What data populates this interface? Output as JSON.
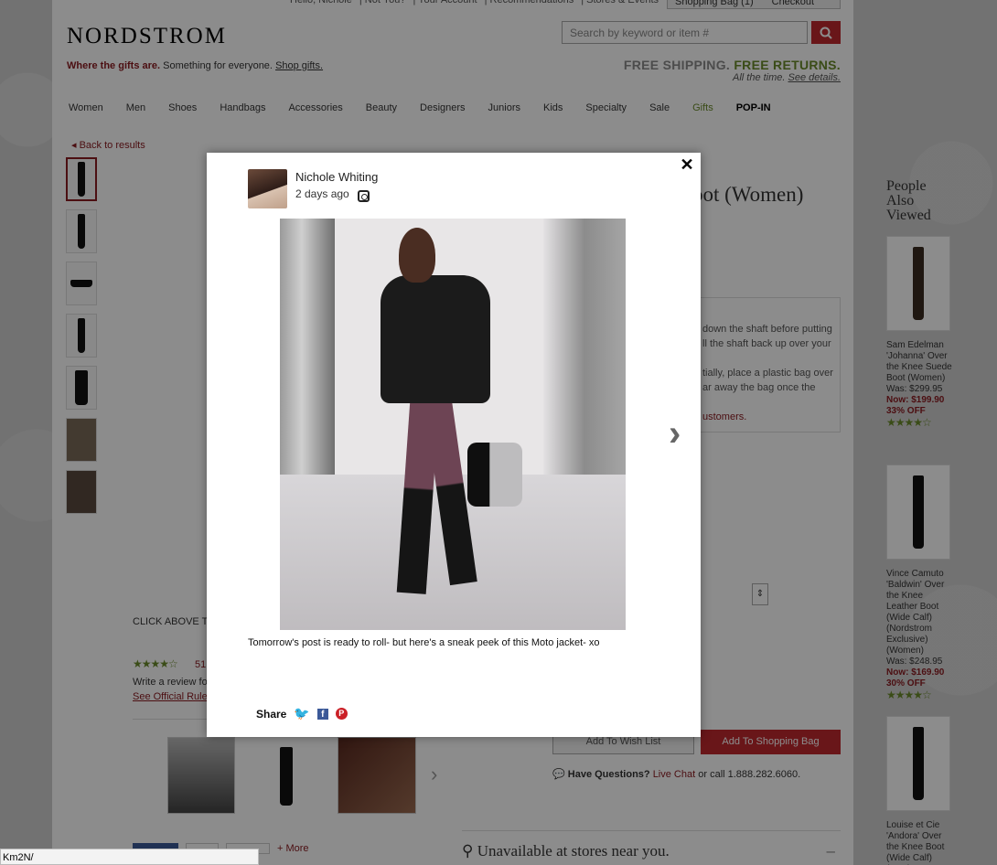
{
  "header": {
    "logo": "NORDSTROM",
    "search_placeholder": "Search by keyword or item #",
    "promo_bold": "Where the gifts are.",
    "promo_text": "Something for everyone.",
    "promo_link": "Shop gifts.",
    "shipping_line1a": "FREE SHIPPING.",
    "shipping_line1b": "FREE RETURNS.",
    "shipping_line2": "All the time.",
    "shipping_link": "See details."
  },
  "nav": [
    "Women",
    "Men",
    "Shoes",
    "Handbags",
    "Accessories",
    "Beauty",
    "Designers",
    "Juniors",
    "Kids",
    "Specialty",
    "Sale",
    "Gifts",
    "POP-IN"
  ],
  "product": {
    "back": "Back to results",
    "title_partial": "oot (Women)",
    "care_line1": "down the shaft before putting",
    "care_line2": "ll the shaft back up over your",
    "care_line3": "tially, place a plastic bag over",
    "care_line4": "ar away the bag once the",
    "care_link": "ustomers.",
    "wish_button": "Add To Wish List",
    "bag_button": "Add To Shopping Bag",
    "have_questions": "Have Questions?",
    "live_chat": "Live Chat",
    "call_text": "or call 1.888.282.6060.",
    "unavailable": "Unavailable at stores near you.",
    "unavailable_toggle": "–"
  },
  "reviews": {
    "click_above": "CLICK ABOVE TO",
    "stars": "★★★★☆",
    "count": "51",
    "write_review": "Write a review fo",
    "official_rules": "See Official Rule",
    "more": "+ More"
  },
  "people_also_viewed": {
    "heading": "People Also Viewed",
    "items": [
      {
        "name": "Sam Edelman 'Johanna' Over the Knee Suede Boot (Women)",
        "was": "Was: $299.95",
        "now": "Now: $199.90",
        "off": "33% OFF",
        "stars": "★★★★☆"
      },
      {
        "name": "Vince Camuto 'Baldwin' Over the Knee Leather Boot (Wide Calf) (Nordstrom Exclusive) (Women)",
        "was": "Was: $248.95",
        "now": "Now: $169.90",
        "off": "30% OFF",
        "stars": "★★★★☆"
      },
      {
        "name": "Louise et Cie 'Andora' Over the Knee Boot (Wide Calf) (Nordstrom",
        "was": "",
        "now": "",
        "off": "",
        "stars": ""
      }
    ]
  },
  "modal": {
    "user_name": "Nichole Whiting",
    "time_ago": "2 days ago",
    "caption": "Tomorrow's post is ready to roll- but here's a sneak peek of this Moto jacket- xo",
    "share_label": "Share",
    "close": "✕",
    "next": "›"
  },
  "status_bar": "Km2N/"
}
